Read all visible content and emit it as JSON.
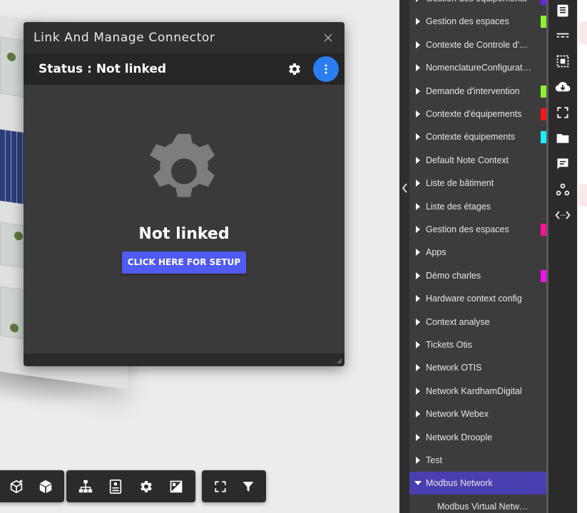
{
  "dialog": {
    "title": "Link And Manage Connector",
    "status": "Status : Not linked",
    "message": "Not linked",
    "setup_button": "CLICK HERE FOR SETUP"
  },
  "toolbar": {
    "groups": [
      [
        "view-3d-icon",
        "cube-icon"
      ],
      [
        "hierarchy-icon",
        "list-detail-icon",
        "settings-icon",
        "aspect-icon"
      ],
      [
        "fullscreen-icon",
        "filter-icon"
      ]
    ]
  },
  "tree": {
    "items": [
      {
        "label": "Gestion des équipements",
        "color": "#5b2ee6"
      },
      {
        "label": "Gestion des espaces",
        "color": "#8df22c"
      },
      {
        "label": "Contexte de Controle d'Accès",
        "color": null
      },
      {
        "label": "NomenclatureConfiguration",
        "color": null
      },
      {
        "label": "Demande d'intervention",
        "color": "#8df22c"
      },
      {
        "label": "Contexte d'équipements",
        "color": "#ff1515"
      },
      {
        "label": "Contexte équipements",
        "color": "#19f0ff"
      },
      {
        "label": "Default Note Context",
        "color": null
      },
      {
        "label": "Liste de bâtiment",
        "color": null
      },
      {
        "label": "Liste des étages",
        "color": null
      },
      {
        "label": "Gestion des espaces",
        "color": "#ff1493"
      },
      {
        "label": "Apps",
        "color": null
      },
      {
        "label": "Démo charles",
        "color": "#f010f0"
      },
      {
        "label": "Hardware context config",
        "color": null
      },
      {
        "label": "Context analyse",
        "color": null
      },
      {
        "label": "Tickets Otis",
        "color": null
      },
      {
        "label": "Network OTIS",
        "color": null
      },
      {
        "label": "Network KardhamDigital",
        "color": null
      },
      {
        "label": "Network Webex",
        "color": null
      },
      {
        "label": "Network Droople",
        "color": null
      },
      {
        "label": "Test",
        "color": null
      },
      {
        "label": "Modbus Network",
        "color": null,
        "selected": true
      }
    ],
    "sub_item": "Modbus Virtual Network"
  },
  "iconbar": [
    "document-icon",
    "separator-icon",
    "select-region-icon",
    "cloud-download-icon",
    "focus-icon",
    "folder-icon",
    "comment-icon",
    "graph-icon",
    "code-arrows-icon"
  ],
  "colors": {
    "accent": "#2b7ef0",
    "setup": "#4f5bf2",
    "selected": "#4a3fb0"
  }
}
